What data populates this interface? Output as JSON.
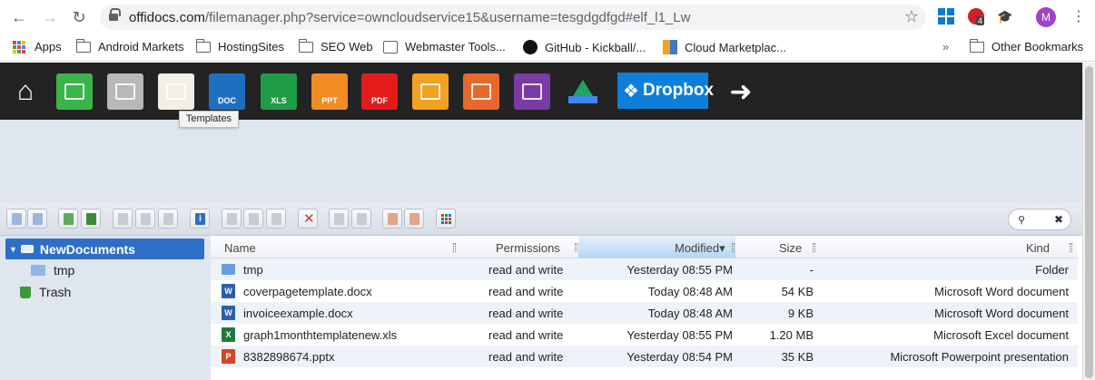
{
  "browser": {
    "url_host": "offidocs.com",
    "url_path": "/filemanager.php?service=owncloudservice15&username=tesgdgdfgd#elf_l1_Lw",
    "extension_badge": "4",
    "avatar_letter": "M"
  },
  "bookmarks": {
    "items": [
      "Apps",
      "Android Markets",
      "HostingSites",
      "SEO Web",
      "Webmaster Tools...",
      "GitHub - Kickball/...",
      "Cloud Marketplac..."
    ],
    "overflow": "»",
    "other": "Other Bookmarks"
  },
  "apptoolbar": {
    "icons": [
      {
        "name": "home-icon",
        "color": "#232323",
        "label": ""
      },
      {
        "name": "remote-desktop-icon",
        "color": "#3bb54a",
        "label": ""
      },
      {
        "name": "linux-icon",
        "color": "#b8b8b8",
        "label": ""
      },
      {
        "name": "templates-icon",
        "color": "#f2efe6",
        "label": ""
      },
      {
        "name": "doc-icon",
        "color": "#1f6fc1",
        "label": "DOC"
      },
      {
        "name": "xls-icon",
        "color": "#1f9c46",
        "label": "XLS"
      },
      {
        "name": "ppt-icon",
        "color": "#f28c22",
        "label": "PPT"
      },
      {
        "name": "pdf-icon",
        "color": "#e21b1b",
        "label": "PDF"
      },
      {
        "name": "image-editor-icon",
        "color": "#f3a120",
        "label": ""
      },
      {
        "name": "video-editor-icon",
        "color": "#e9692c",
        "label": ""
      },
      {
        "name": "audio-editor-icon",
        "color": "#7b3aa5",
        "label": ""
      },
      {
        "name": "google-drive-icon",
        "color": "#232323",
        "label": ""
      }
    ],
    "dropbox_label": "Dropbox",
    "tooltip": "Templates"
  },
  "tree": {
    "root": "NewDocuments",
    "children": [
      "tmp"
    ],
    "trash": "Trash"
  },
  "list": {
    "columns": {
      "name": "Name",
      "permissions": "Permissions",
      "modified": "Modified",
      "size": "Size",
      "kind": "Kind"
    },
    "sort_indicator": "▾",
    "rows": [
      {
        "type": "folder",
        "name": "tmp",
        "permissions": "read and write",
        "modified": "Yesterday 08:55 PM",
        "size": "-",
        "kind": "Folder"
      },
      {
        "type": "word",
        "name": "coverpagetemplate.docx",
        "permissions": "read and write",
        "modified": "Today 08:48 AM",
        "size": "54 KB",
        "kind": "Microsoft Word document"
      },
      {
        "type": "word",
        "name": "invoiceexample.docx",
        "permissions": "read and write",
        "modified": "Today 08:48 AM",
        "size": "9 KB",
        "kind": "Microsoft Word document"
      },
      {
        "type": "excel",
        "name": "graph1monthtemplatenew.xls",
        "permissions": "read and write",
        "modified": "Yesterday 08:55 PM",
        "size": "1.20 MB",
        "kind": "Microsoft Excel document"
      },
      {
        "type": "powerpoint",
        "name": "8382898674.pptx",
        "permissions": "read and write",
        "modified": "Yesterday 08:54 PM",
        "size": "35 KB",
        "kind": "Microsoft Powerpoint presentation"
      }
    ]
  },
  "colors": {
    "folder": "#6b9ee0",
    "word": "#2b5fae",
    "excel": "#1f7a3e",
    "powerpoint": "#d24625",
    "selection": "#2f6ec8"
  }
}
